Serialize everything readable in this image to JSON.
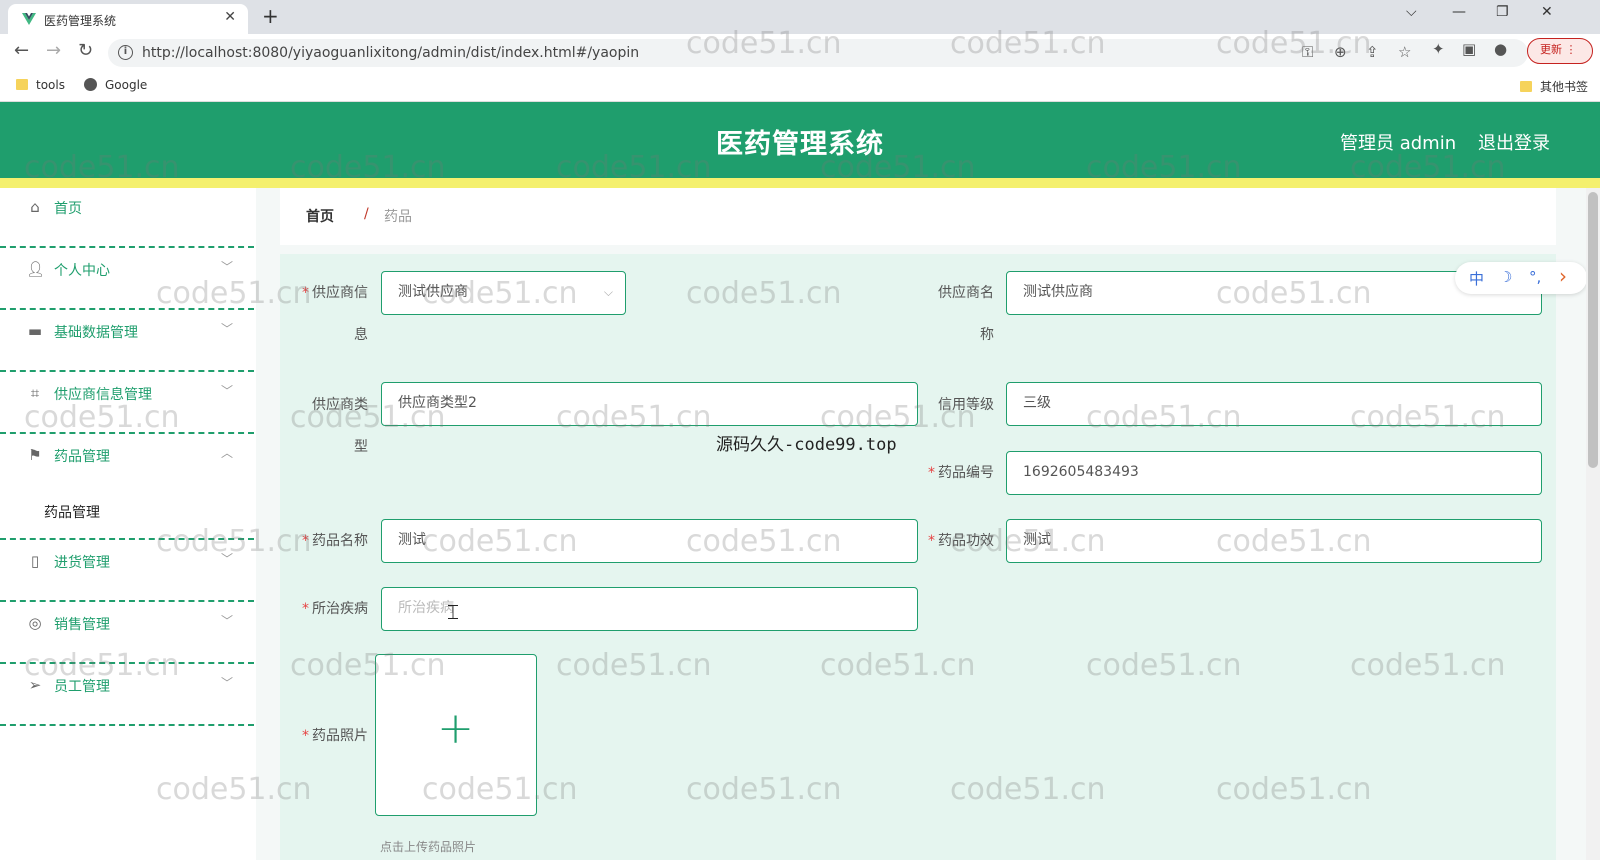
{
  "browser": {
    "tab_title": "医药管理系统",
    "tab_close": "✕",
    "new_tab": "+",
    "url": "http://localhost:8080/yiyaoguanlixitong/admin/dist/index.html#/yaopin",
    "update_label": "更新",
    "bookmarks": [
      {
        "label": "tools",
        "icon": "folder-icon"
      },
      {
        "label": "Google",
        "icon": "globe-icon"
      }
    ],
    "other_bookmarks": "其他书签"
  },
  "header": {
    "title": "医药管理系统",
    "user": "管理员 admin",
    "logout": "退出登录",
    "color": "#1f9e6d",
    "accent_bar_color": "#f4f06e"
  },
  "sidebar": {
    "items": [
      {
        "label": "首页",
        "icon": "home-icon"
      },
      {
        "label": "个人中心",
        "icon": "user-icon"
      },
      {
        "label": "基础数据管理",
        "icon": "monitor-icon"
      },
      {
        "label": "供应商信息管理",
        "icon": "crop-icon"
      },
      {
        "label": "药品管理",
        "icon": "flag-icon"
      },
      {
        "label": "进货管理",
        "icon": "phone-icon"
      },
      {
        "label": "销售管理",
        "icon": "target-icon"
      },
      {
        "label": "员工管理",
        "icon": "send-icon"
      }
    ],
    "submenu": {
      "label": "药品管理"
    }
  },
  "breadcrumb": {
    "home": "首页",
    "separator": "/",
    "current": "药品"
  },
  "form": {
    "supplier_info_label_line1": "供应商信",
    "supplier_info_label_line2": "息",
    "supplier_info_value": "测试供应商",
    "supplier_name_label_line1": "供应商名",
    "supplier_name_label_line2": "称",
    "supplier_name_value": "测试供应商",
    "supplier_type_label_line1": "供应商类",
    "supplier_type_label_line2": "型",
    "supplier_type_value": "供应商类型2",
    "credit_label": "信用等级",
    "credit_value": "三级",
    "drug_code_label": "药品编号",
    "drug_code_value": "1692605483493",
    "drug_name_label": "药品名称",
    "drug_name_value": "测试",
    "drug_effect_label": "药品功效",
    "drug_effect_value": "测试",
    "disease_label": "所治疾病",
    "disease_placeholder": "所治疾病",
    "photo_label": "药品照片",
    "upload_plus": "+",
    "upload_hint": "点击上传药品照片",
    "required_mark": "*"
  },
  "overlay_text": "源码久久-code99.top",
  "ime": {
    "zh": "中",
    "moon": "☽",
    "dots": "°,",
    "arrow": "›"
  },
  "watermark": "code51.cn"
}
